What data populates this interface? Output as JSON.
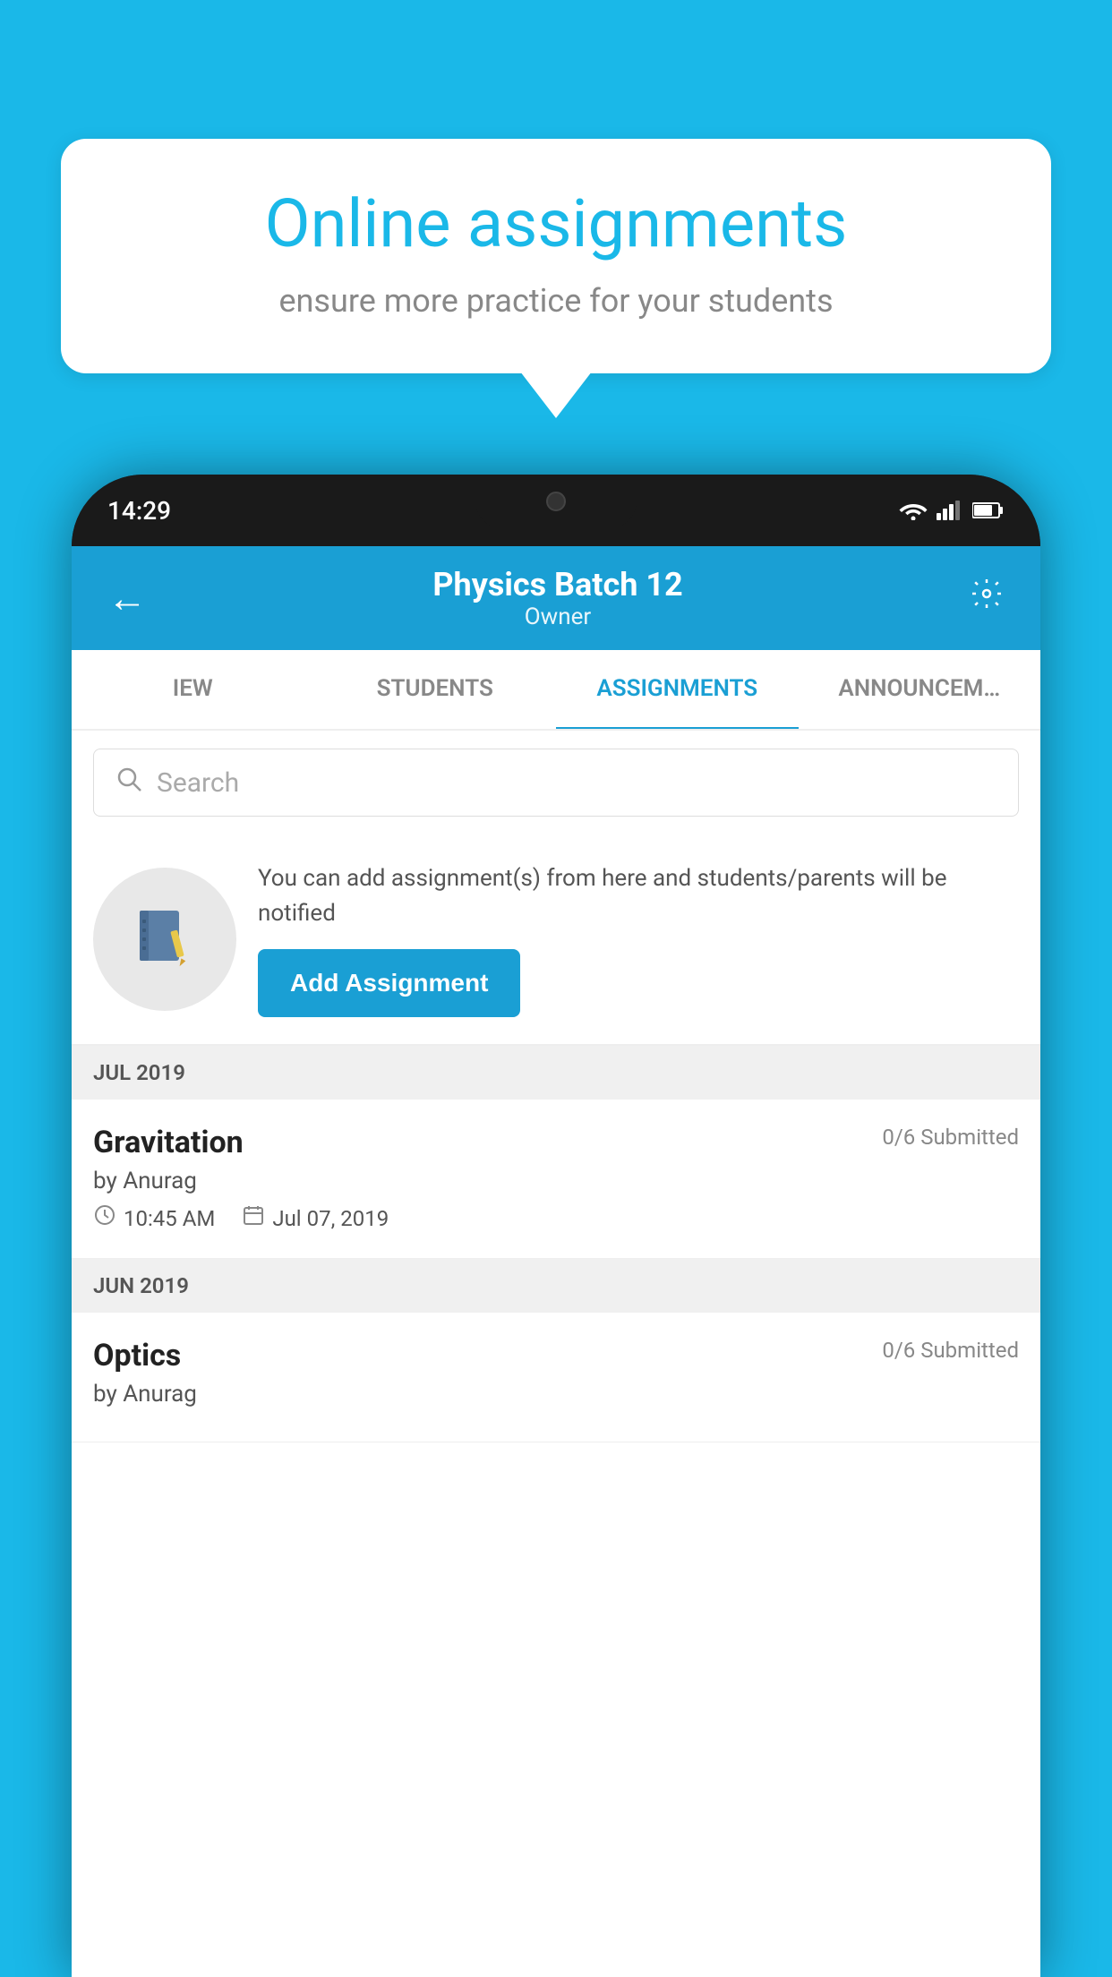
{
  "background_color": "#1ab8e8",
  "bubble": {
    "title": "Online assignments",
    "subtitle": "ensure more practice for your students"
  },
  "phone": {
    "status_bar": {
      "time": "14:29",
      "wifi_icon": "wifi-icon",
      "signal_icon": "signal-icon",
      "battery_icon": "battery-icon"
    },
    "header": {
      "back_label": "←",
      "title": "Physics Batch 12",
      "subtitle": "Owner",
      "settings_icon": "settings-icon"
    },
    "tabs": [
      {
        "label": "IEW",
        "active": false
      },
      {
        "label": "STUDENTS",
        "active": false
      },
      {
        "label": "ASSIGNMENTS",
        "active": true
      },
      {
        "label": "ANNOUNCEM…",
        "active": false
      }
    ],
    "search": {
      "placeholder": "Search"
    },
    "promo": {
      "text": "You can add assignment(s) from here and students/parents will be notified",
      "button_label": "Add Assignment"
    },
    "sections": [
      {
        "label": "JUL 2019",
        "assignments": [
          {
            "name": "Gravitation",
            "submitted": "0/6 Submitted",
            "by": "by Anurag",
            "time": "10:45 AM",
            "date": "Jul 07, 2019"
          }
        ]
      },
      {
        "label": "JUN 2019",
        "assignments": [
          {
            "name": "Optics",
            "submitted": "0/6 Submitted",
            "by": "by Anurag",
            "time": "",
            "date": ""
          }
        ]
      }
    ]
  }
}
